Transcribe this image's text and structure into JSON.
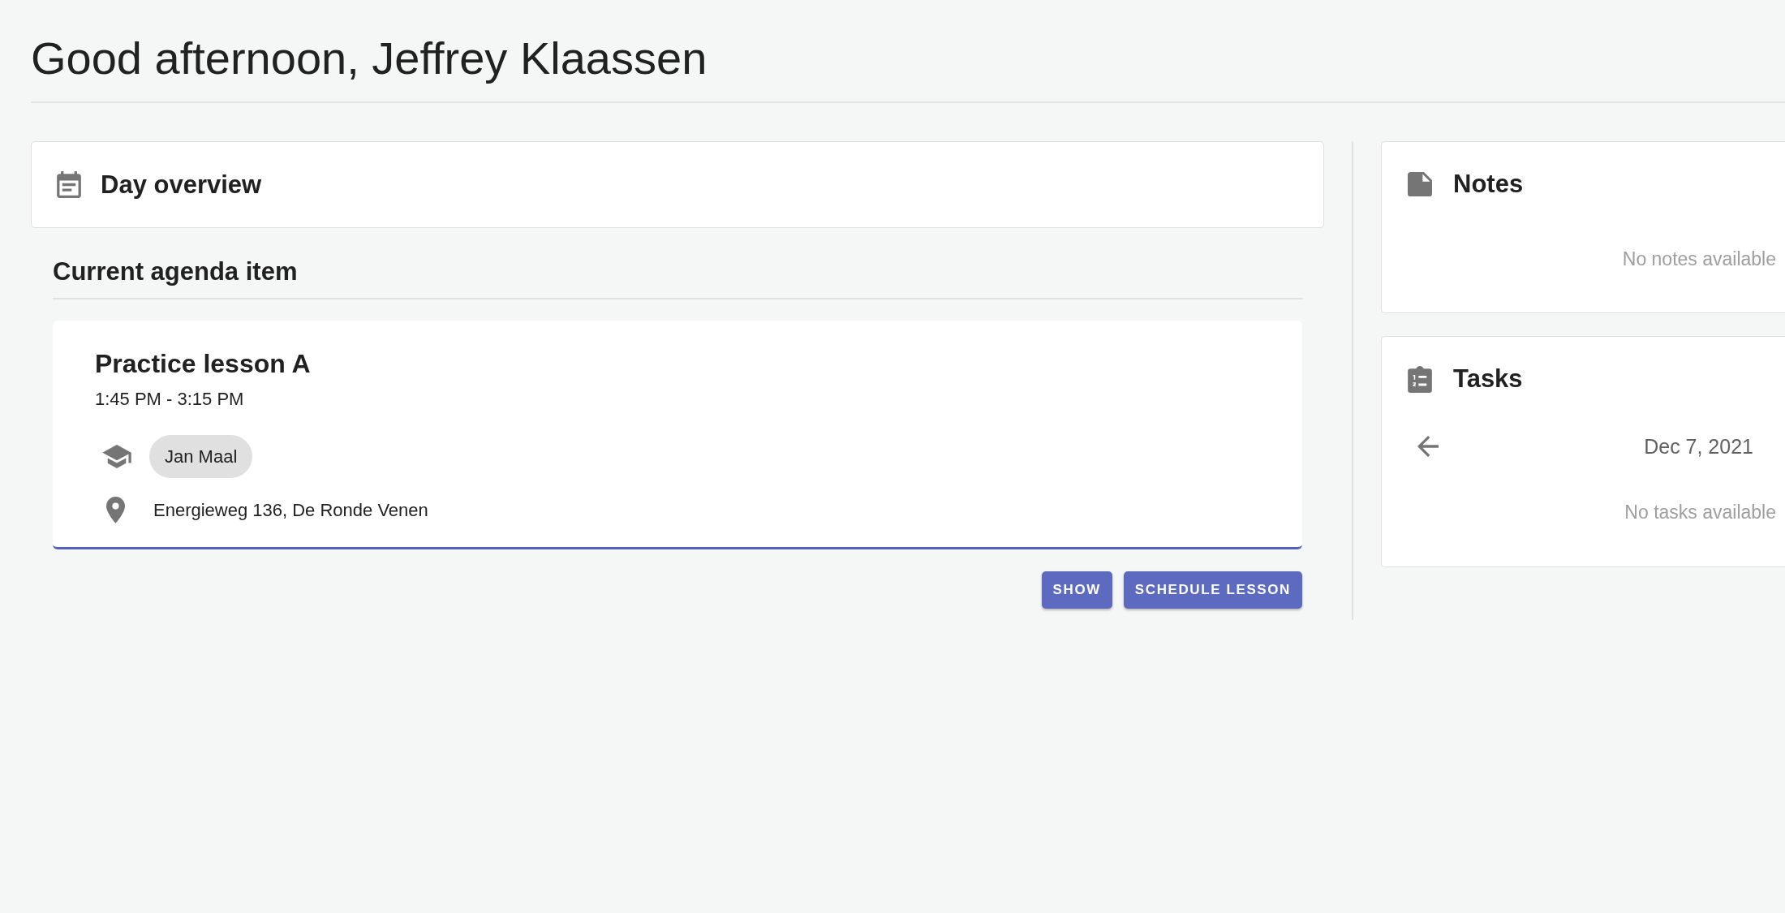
{
  "greeting": "Good afternoon, Jeffrey Klaassen",
  "day_overview": {
    "title": "Day overview"
  },
  "current_agenda": {
    "heading": "Current agenda item",
    "item": {
      "title": "Practice lesson A",
      "time": "1:45 PM - 3:15 PM",
      "students": [
        "Jan Maal"
      ],
      "location": "Energieweg 136, De Ronde Venen"
    },
    "buttons": [
      "SHOW",
      "SCHEDULE LESSON"
    ]
  },
  "notes": {
    "title": "Notes",
    "empty_text": "No notes available"
  },
  "tasks": {
    "title": "Tasks",
    "date": "Dec 7, 2021",
    "empty_text": "No tasks available"
  }
}
